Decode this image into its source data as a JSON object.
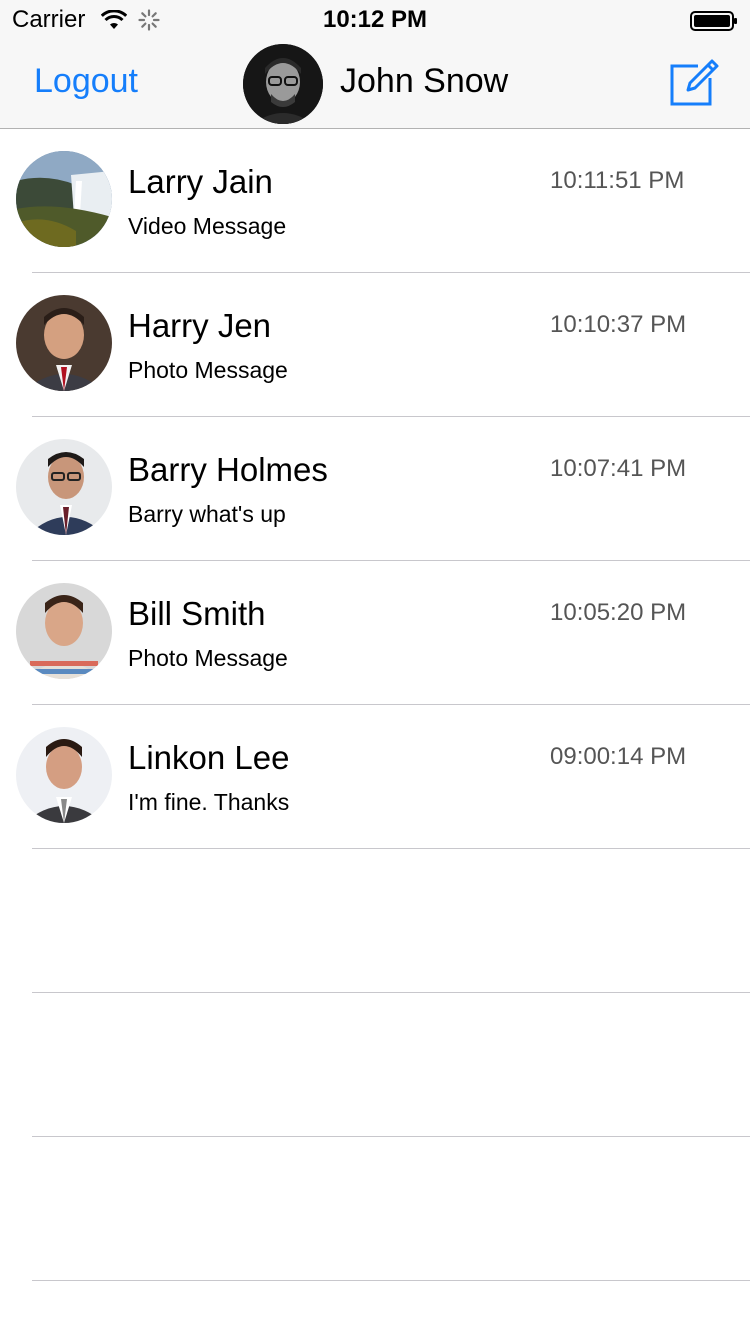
{
  "status_bar": {
    "carrier": "Carrier",
    "time": "10:12 PM",
    "icons": [
      "wifi-icon",
      "activity-spinner-icon",
      "battery-icon"
    ]
  },
  "nav": {
    "logout_label": "Logout",
    "title": "John Snow",
    "compose_icon": "compose-icon",
    "accent_color": "#157efb"
  },
  "conversations": [
    {
      "name": "Larry Jain",
      "preview": "Video Message",
      "time": "10:11:51 PM",
      "avatar": "waterfall-photo"
    },
    {
      "name": "Harry Jen",
      "preview": "Photo Message",
      "time": "10:10:37 PM",
      "avatar": "person-photo"
    },
    {
      "name": "Barry Holmes",
      "preview": "Barry what's up",
      "time": "10:07:41 PM",
      "avatar": "person-photo"
    },
    {
      "name": "Bill Smith",
      "preview": "Photo Message",
      "time": "10:05:20 PM",
      "avatar": "person-photo"
    },
    {
      "name": "Linkon Lee",
      "preview": "I'm fine. Thanks",
      "time": "09:00:14 PM",
      "avatar": "person-photo"
    }
  ]
}
